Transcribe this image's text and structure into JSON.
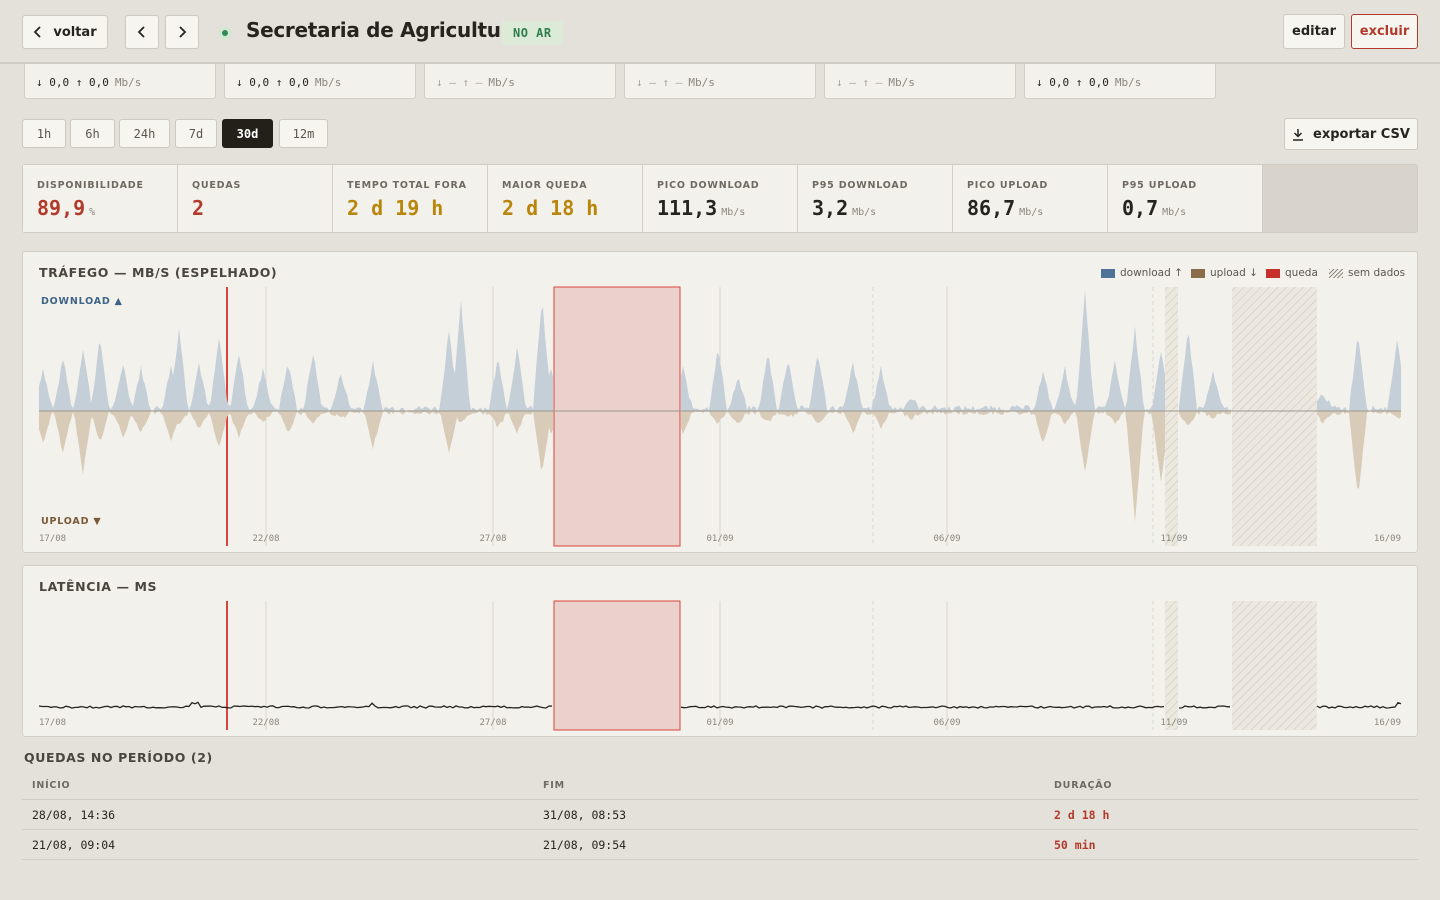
{
  "header": {
    "back_label": "voltar",
    "title": "Secretaria de Agricultura",
    "status_badge": "NO AR",
    "edit_label": "editar",
    "delete_label": "excluir"
  },
  "interfaces": [
    {
      "rates": "↓ 0,0 ↑ 0,0",
      "unit": "Mb/s",
      "state": "up"
    },
    {
      "rates": "↓ 0,0 ↑ 0,0",
      "unit": "Mb/s",
      "state": "up"
    },
    {
      "rates": "↓ — ↑ —",
      "unit": "Mb/s",
      "state": "down"
    },
    {
      "rates": "↓ — ↑ —",
      "unit": "Mb/s",
      "state": "down"
    },
    {
      "rates": "↓ — ↑ —",
      "unit": "Mb/s",
      "state": "down"
    },
    {
      "rates": "↓ 0,0 ↑ 0,0",
      "unit": "Mb/s",
      "state": "up"
    }
  ],
  "ranges": [
    {
      "label": "1h",
      "active": false
    },
    {
      "label": "6h",
      "active": false
    },
    {
      "label": "24h",
      "active": false
    },
    {
      "label": "7d",
      "active": false
    },
    {
      "label": "30d",
      "active": true
    },
    {
      "label": "12m",
      "active": false
    }
  ],
  "export_label": "exportar CSV",
  "stats": [
    {
      "label": "DISPONIBILIDADE",
      "value": "89,9",
      "unit": "%",
      "color": "#b23a2c"
    },
    {
      "label": "QUEDAS",
      "value": "2",
      "unit": "",
      "color": "#b23a2c"
    },
    {
      "label": "TEMPO TOTAL FORA",
      "value": "2 d 19 h",
      "unit": "",
      "color": "#b8860b"
    },
    {
      "label": "MAIOR QUEDA",
      "value": "2 d 18 h",
      "unit": "",
      "color": "#b8860b"
    },
    {
      "label": "PICO DOWNLOAD",
      "value": "111,3",
      "unit": "Mb/s",
      "color": "#26241f"
    },
    {
      "label": "P95 DOWNLOAD",
      "value": "3,2",
      "unit": "Mb/s",
      "color": "#26241f"
    },
    {
      "label": "PICO UPLOAD",
      "value": "86,7",
      "unit": "Mb/s",
      "color": "#26241f"
    },
    {
      "label": "P95 UPLOAD",
      "value": "0,7",
      "unit": "Mb/s",
      "color": "#26241f"
    }
  ],
  "traffic": {
    "title": "TRÁFEGO — MB/S (ESPELHADO)",
    "download_tag": "DOWNLOAD ▲",
    "upload_tag": "UPLOAD ▼",
    "legend": [
      {
        "label": "download ↑",
        "color": "#4f7398"
      },
      {
        "label": "upload ↓",
        "color": "#8a6b4a"
      },
      {
        "label": "queda",
        "color": "#c62f2a"
      },
      {
        "label": "sem dados",
        "color": "hatch"
      }
    ],
    "x_ticks": [
      "17/08",
      "22/08",
      "27/08",
      "01/09",
      "06/09",
      "11/09",
      "16/09"
    ]
  },
  "latency": {
    "title": "LATÊNCIA — MS",
    "x_ticks": [
      "17/08",
      "22/08",
      "27/08",
      "01/09",
      "06/09",
      "11/09",
      "16/09"
    ]
  },
  "colors": {
    "download_fill": "#c5cfd8",
    "upload_fill": "#d8cbb8",
    "outage_fill": "#ebd1cb",
    "outage_stroke": "#d9453c"
  },
  "outages": {
    "title": "QUEDAS NO PERÍODO (2)",
    "columns": [
      "INÍCIO",
      "FIM",
      "DURAÇÃO"
    ],
    "rows": [
      {
        "start": "28/08, 14:36",
        "end": "31/08, 08:53",
        "duration": "2 d 18 h"
      },
      {
        "start": "21/08, 09:04",
        "end": "21/08, 09:54",
        "duration": "50 min"
      }
    ]
  }
}
